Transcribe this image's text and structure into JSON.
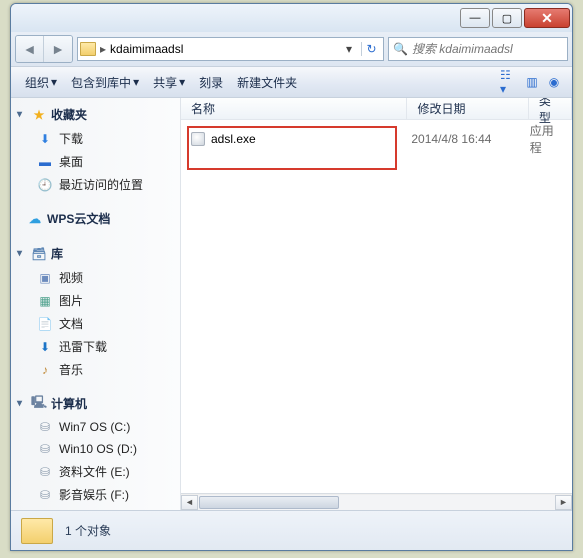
{
  "addressbar": {
    "path": "kdaimimaadsl",
    "sep": "▸"
  },
  "search": {
    "placeholder": "搜索 kdaimimaadsl"
  },
  "toolbar": {
    "organize": "组织",
    "include": "包含到库中",
    "share": "共享",
    "burn": "刻录",
    "newfolder": "新建文件夹"
  },
  "columns": {
    "name": "名称",
    "date": "修改日期",
    "type": "类型"
  },
  "files": [
    {
      "name": "adsl.exe",
      "date": "2014/4/8 16:44",
      "type": "应用程"
    }
  ],
  "sidebar": {
    "favorites": {
      "label": "收藏夹",
      "items": [
        {
          "icon": "dl",
          "glyph": "⬇",
          "label": "下载"
        },
        {
          "icon": "desk",
          "glyph": "▬",
          "label": "桌面"
        },
        {
          "icon": "rec",
          "glyph": "🕘",
          "label": "最近访问的位置"
        }
      ]
    },
    "wps": {
      "icon": "cloud",
      "glyph": "☁",
      "label": "WPS云文档"
    },
    "libraries": {
      "label": "库",
      "items": [
        {
          "icon": "vid",
          "glyph": "▣",
          "label": "视频"
        },
        {
          "icon": "pic",
          "glyph": "▦",
          "label": "图片"
        },
        {
          "icon": "doc",
          "glyph": "📄",
          "label": "文档"
        },
        {
          "icon": "xl",
          "glyph": "⬇",
          "label": "迅雷下载"
        },
        {
          "icon": "mus",
          "glyph": "♪",
          "label": "音乐"
        }
      ]
    },
    "computer": {
      "label": "计算机",
      "items": [
        {
          "icon": "drv",
          "glyph": "⛁",
          "label": "Win7 OS (C:)"
        },
        {
          "icon": "drv",
          "glyph": "⛁",
          "label": "Win10 OS (D:)"
        },
        {
          "icon": "drv",
          "glyph": "⛁",
          "label": "资料文件 (E:)"
        },
        {
          "icon": "drv",
          "glyph": "⛁",
          "label": "影音娱乐 (F:)"
        }
      ]
    }
  },
  "status": {
    "count": "1 个对象"
  }
}
